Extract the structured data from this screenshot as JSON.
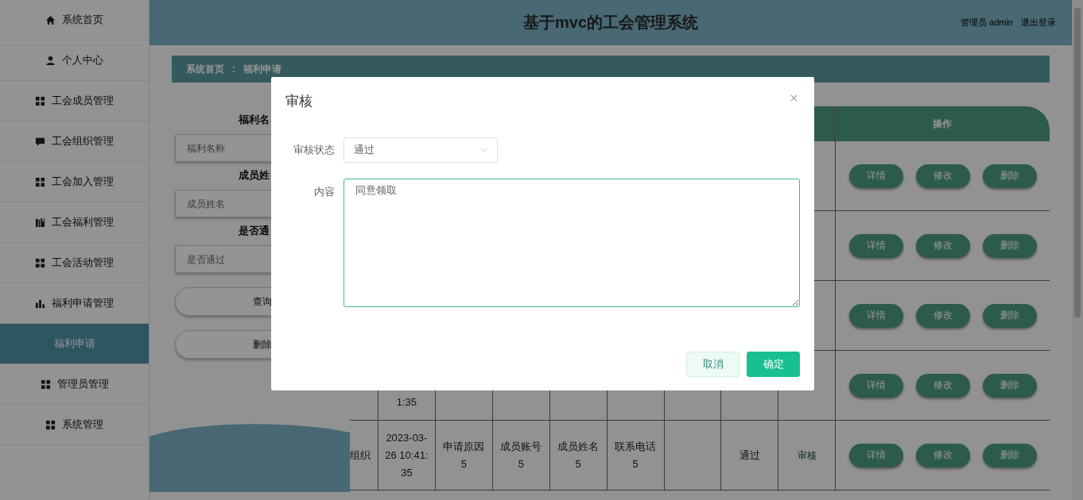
{
  "sidebar": {
    "items": [
      {
        "label": "系统首页",
        "kind": "home",
        "selected": false
      },
      {
        "label": "个人中心",
        "kind": "user",
        "selected": false
      },
      {
        "label": "工会成员管理",
        "kind": "grid",
        "selected": false
      },
      {
        "label": "工会组织管理",
        "kind": "chat",
        "selected": false
      },
      {
        "label": "工会加入管理",
        "kind": "grid",
        "selected": false
      },
      {
        "label": "工会福利管理",
        "kind": "books",
        "selected": false
      },
      {
        "label": "工会活动管理",
        "kind": "grid",
        "selected": false
      },
      {
        "label": "福利申请管理",
        "kind": "bars",
        "selected": false
      },
      {
        "label": "福利申请",
        "kind": "plain",
        "selected": true
      },
      {
        "label": "管理员管理",
        "kind": "grid",
        "selected": false
      },
      {
        "label": "系统管理",
        "kind": "grid",
        "selected": false
      }
    ]
  },
  "header": {
    "title": "基于mvc的工会管理系统",
    "user": "管理员 admin",
    "logout": "退出登录"
  },
  "breadcrumb": {
    "items": [
      "系统首页",
      "福利申请"
    ],
    "separator": ":"
  },
  "search": {
    "fields": [
      {
        "label": "福利名",
        "placeholder": "福利名称"
      },
      {
        "label": "成员姓",
        "placeholder": "成员姓名"
      },
      {
        "label": "是否通",
        "placeholder": "是否通过"
      }
    ],
    "buttons": [
      "查询",
      "删除"
    ]
  },
  "table": {
    "action_header": "操作",
    "rows": [
      {
        "cells": [],
        "actions": [
          "详情",
          "修改",
          "删除"
        ]
      },
      {
        "cells": [],
        "actions": [
          "详情",
          "修改",
          "删除"
        ]
      },
      {
        "cells": [],
        "actions": [
          "详情",
          "修改",
          "删除"
        ]
      },
      {
        "cut_top": true,
        "cells": [
          null,
          "1:35"
        ],
        "actions": [
          "详情",
          "修改",
          "删除"
        ]
      },
      {
        "cells": [
          "组织",
          "2023-03-26 10:41:35",
          "申请原因5",
          "成员账号5",
          "成员姓名5",
          "联系电话5",
          null,
          "通过",
          "审核"
        ],
        "actions": [
          "详情",
          "修改",
          "删除"
        ]
      }
    ]
  },
  "dialog": {
    "title": "审核",
    "status_label": "审核状态",
    "status_value": "通过",
    "content_label": "内容",
    "content_value": "同意领取",
    "buttons": [
      {
        "label": "取消",
        "kind": "secondary"
      },
      {
        "label": "确定",
        "kind": "primary"
      }
    ]
  }
}
